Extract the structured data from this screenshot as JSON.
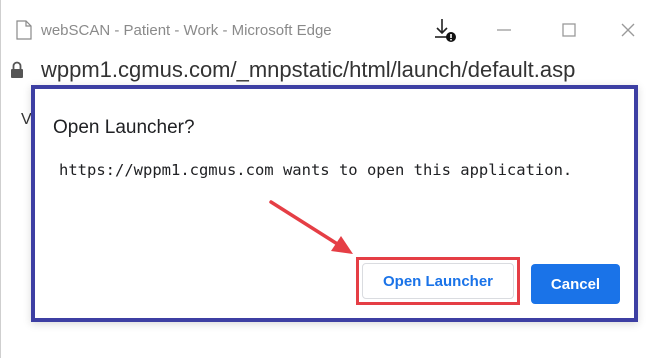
{
  "window": {
    "title": "webSCAN - Patient - Work - Microsoft Edge",
    "controls": [
      "minimize-icon",
      "maximize-icon",
      "close-icon"
    ]
  },
  "address_bar": {
    "url": "wppm1.cgmus.com/_mnpstatic/html/launch/default.asp"
  },
  "page": {
    "partial_text": "V"
  },
  "dialog": {
    "title": "Open Launcher?",
    "message": "https://wppm1.cgmus.com wants to open this application.",
    "open_button_label": "Open Launcher",
    "cancel_button_label": "Cancel"
  },
  "colors": {
    "dialog_border": "#3d3fa3",
    "highlight": "#e53e45",
    "primary": "#1a73e8"
  }
}
